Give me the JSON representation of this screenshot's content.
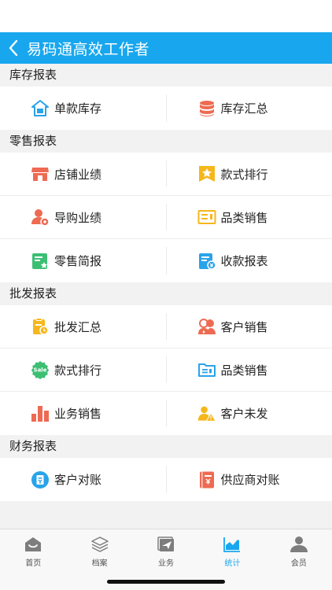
{
  "header": {
    "title": "易码通高效工作者"
  },
  "sections": [
    {
      "title": "库存报表",
      "rows": [
        [
          {
            "label": "单款库存",
            "icon": "house-box-icon"
          },
          {
            "label": "库存汇总",
            "icon": "database-stack-icon"
          }
        ]
      ]
    },
    {
      "title": "零售报表",
      "rows": [
        [
          {
            "label": "店铺业绩",
            "icon": "storefront-icon"
          },
          {
            "label": "款式排行",
            "icon": "star-bookmark-icon"
          }
        ],
        [
          {
            "label": "导购业绩",
            "icon": "user-badge-icon"
          },
          {
            "label": "品类销售",
            "icon": "category-list-icon"
          }
        ],
        [
          {
            "label": "零售简报",
            "icon": "star-report-icon"
          },
          {
            "label": "收款报表",
            "icon": "payment-report-icon"
          }
        ]
      ]
    },
    {
      "title": "批发报表",
      "rows": [
        [
          {
            "label": "批发汇总",
            "icon": "clipboard-clock-icon"
          },
          {
            "label": "客户销售",
            "icon": "customers-icon"
          }
        ],
        [
          {
            "label": "款式排行",
            "icon": "sale-badge-icon"
          },
          {
            "label": "品类销售",
            "icon": "folder-list-icon"
          }
        ],
        [
          {
            "label": "业务销售",
            "icon": "bar-chart-icon"
          },
          {
            "label": "客户未发",
            "icon": "user-warning-icon"
          }
        ]
      ]
    },
    {
      "title": "财务报表",
      "rows": [
        [
          {
            "label": "客户对账",
            "icon": "ledger-circle-icon"
          },
          {
            "label": "供应商对账",
            "icon": "ledger-book-icon"
          }
        ]
      ]
    }
  ],
  "tabs": [
    {
      "label": "首页",
      "icon": "home-icon",
      "active": false
    },
    {
      "label": "档案",
      "icon": "layers-icon",
      "active": false
    },
    {
      "label": "业务",
      "icon": "paper-plane-icon",
      "active": false
    },
    {
      "label": "统计",
      "icon": "area-chart-icon",
      "active": true
    },
    {
      "label": "会员",
      "icon": "member-icon",
      "active": false
    }
  ],
  "colors": {
    "header": "#18a7ee",
    "active_tab": "#18a7ee"
  }
}
